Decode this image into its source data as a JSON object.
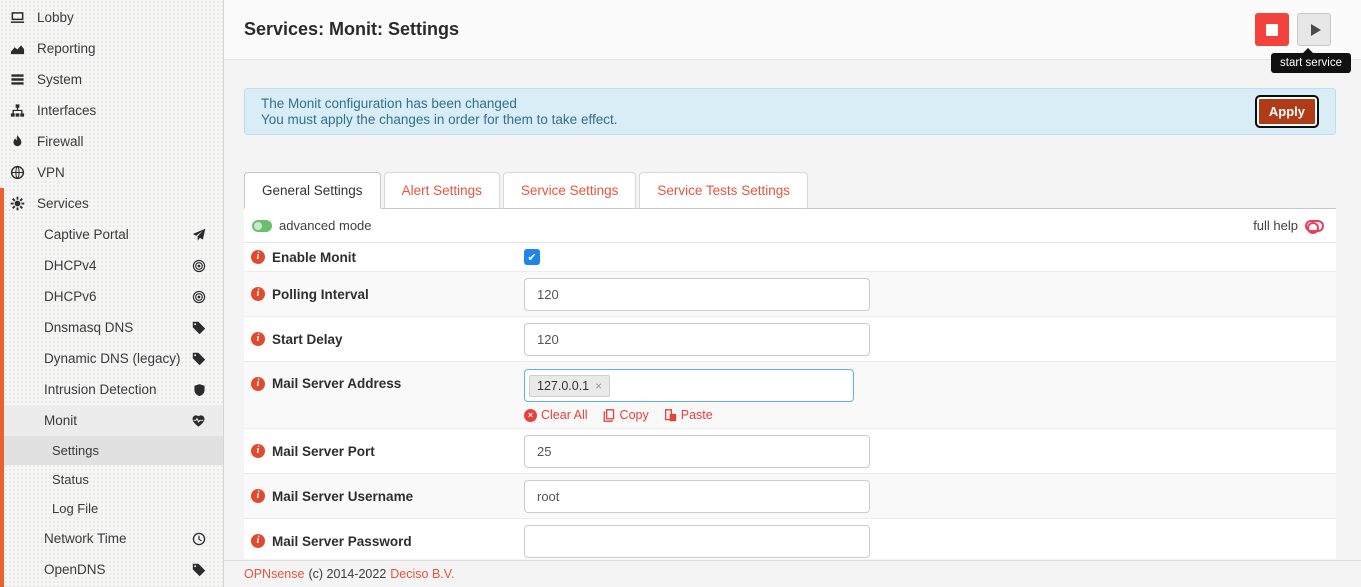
{
  "sidebar": {
    "items": [
      {
        "label": "Lobby",
        "icon": "laptop-icon",
        "level": 0
      },
      {
        "label": "Reporting",
        "icon": "area-chart-icon",
        "level": 0
      },
      {
        "label": "System",
        "icon": "list-icon",
        "level": 0
      },
      {
        "label": "Interfaces",
        "icon": "sitemap-icon",
        "level": 0
      },
      {
        "label": "Firewall",
        "icon": "fire-icon",
        "level": 0
      },
      {
        "label": "VPN",
        "icon": "globe-icon",
        "level": 0
      },
      {
        "label": "Services",
        "icon": "gear-icon",
        "level": 0,
        "active_section": true
      },
      {
        "label": "Captive Portal",
        "icon_right": "paper-plane-icon",
        "level": 1
      },
      {
        "label": "DHCPv4",
        "icon_right": "bullseye-icon",
        "level": 1
      },
      {
        "label": "DHCPv6",
        "icon_right": "bullseye-icon",
        "level": 1
      },
      {
        "label": "Dnsmasq DNS",
        "icon_right": "tag-icon",
        "level": 1
      },
      {
        "label": "Dynamic DNS (legacy)",
        "icon_right": "tag-icon",
        "level": 1
      },
      {
        "label": "Intrusion Detection",
        "icon_right": "shield-icon",
        "level": 1
      },
      {
        "label": "Monit",
        "icon_right": "heartbeat-icon",
        "level": 1,
        "highlighted": true
      },
      {
        "label": "Settings",
        "level": 2,
        "active": true
      },
      {
        "label": "Status",
        "level": 2
      },
      {
        "label": "Log File",
        "level": 2
      },
      {
        "label": "Network Time",
        "icon_right": "clock-icon",
        "level": 1
      },
      {
        "label": "OpenDNS",
        "icon_right": "tag-icon",
        "level": 1
      }
    ]
  },
  "header": {
    "title": "Services: Monit: Settings",
    "tooltip": "start service"
  },
  "banner": {
    "line1": "The Monit configuration has been changed",
    "line2": "You must apply the changes in order for them to take effect.",
    "apply_label": "Apply"
  },
  "tabs": [
    {
      "label": "General Settings",
      "active": true
    },
    {
      "label": "Alert Settings",
      "active": false
    },
    {
      "label": "Service Settings",
      "active": false
    },
    {
      "label": "Service Tests Settings",
      "active": false
    }
  ],
  "options_bar": {
    "advanced_mode_label": "advanced mode",
    "full_help_label": "full help"
  },
  "form": {
    "rows": [
      {
        "label": "Enable Monit",
        "type": "checkbox",
        "checked": true
      },
      {
        "label": "Polling Interval",
        "type": "text",
        "value": "120"
      },
      {
        "label": "Start Delay",
        "type": "text",
        "value": "120"
      },
      {
        "label": "Mail Server Address",
        "type": "tokens",
        "tokens": [
          "127.0.0.1"
        ],
        "links": [
          {
            "label": "Clear All",
            "icon": "clear-all-icon"
          },
          {
            "label": "Copy",
            "icon": "copy-icon"
          },
          {
            "label": "Paste",
            "icon": "paste-icon"
          }
        ]
      },
      {
        "label": "Mail Server Port",
        "type": "text",
        "value": "25"
      },
      {
        "label": "Mail Server Username",
        "type": "text",
        "value": "root"
      },
      {
        "label": "Mail Server Password",
        "type": "password",
        "value": ""
      }
    ]
  },
  "footer": {
    "brand": "OPNsense",
    "copyright": "(c) 2014-2022",
    "company": "Deciso B.V."
  },
  "colors": {
    "accent_orange": "#e8543c",
    "section_border": "#e8632c",
    "link_red": "#e8413c",
    "info_red": "#e04b2e",
    "checkbox_blue": "#1d86e8",
    "focus_blue": "#5fb2e8",
    "banner_bg": "#d9edf7",
    "banner_border": "#bce0ee",
    "banner_text": "#31708f",
    "apply_bg": "#b23b17",
    "stop_red": "#f4433c",
    "toggle_green": "#6abf6e"
  }
}
